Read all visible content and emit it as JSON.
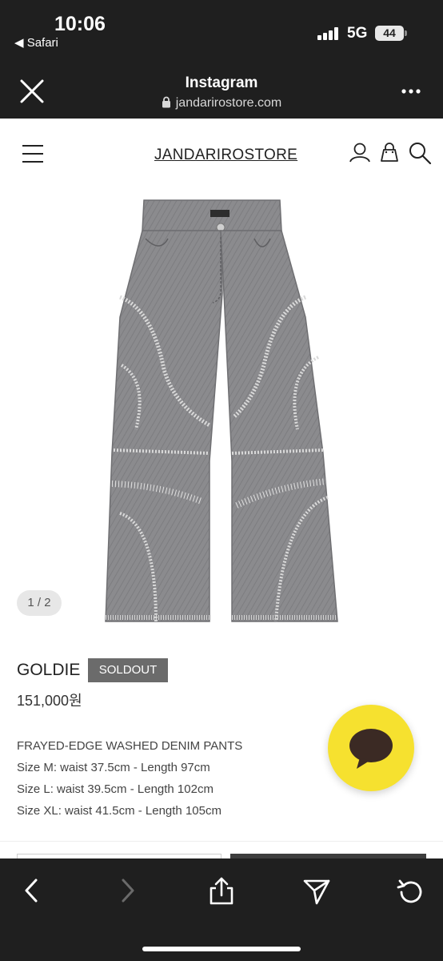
{
  "status_bar": {
    "time": "10:06",
    "back_app": "◀ Safari",
    "network": "5G",
    "battery": "44"
  },
  "browser": {
    "title": "Instagram",
    "url": "jandarirostore.com"
  },
  "site": {
    "brand": "JANDARIROSTORE"
  },
  "product": {
    "image_pager": "1 / 2",
    "name": "GOLDIE",
    "badge": "SOLDOUT",
    "price": "151,000원",
    "description": [
      "FRAYED-EDGE WASHED DENIM PANTS",
      "Size M: waist 37.5cm - Length 97cm",
      "Size L: waist 39.5cm - Length 102cm",
      "Size XL: waist 41.5cm - Length 105cm"
    ]
  },
  "colors": {
    "chrome": "#1f1f1f",
    "soldout_badge": "#6b6b6b",
    "chat_fab": "#f6e12f",
    "denim": "#8a8a8c"
  },
  "icons": {
    "close": "close-icon",
    "more": "more-icon",
    "menu": "hamburger-icon",
    "account": "user-icon",
    "cart": "shopping-bag-icon",
    "search": "search-icon",
    "chat": "chat-bubble-icon",
    "back": "chevron-left-icon",
    "forward": "chevron-right-icon",
    "share": "share-icon",
    "send": "send-icon",
    "reload": "reload-icon"
  }
}
